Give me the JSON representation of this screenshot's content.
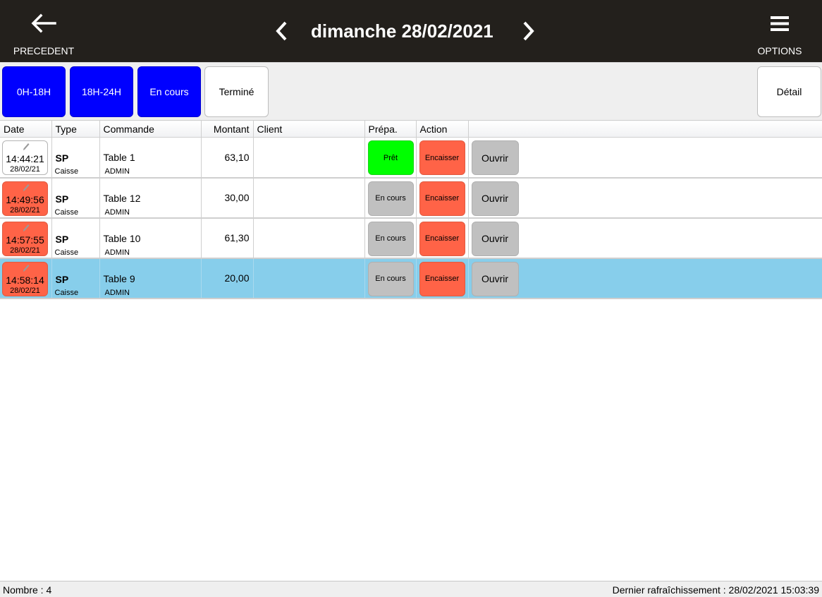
{
  "header": {
    "back_label": "PRECEDENT",
    "back_icon": "arrow-left-icon",
    "date_title": "dimanche 28/02/2021",
    "prev_day_icon": "chevron-left-icon",
    "next_day_icon": "chevron-right-icon",
    "options_label": "OPTIONS",
    "options_icon": "hamburger-menu-icon"
  },
  "filters": {
    "buttons": [
      {
        "label": "0H-18H",
        "active": true
      },
      {
        "label": "18H-24H",
        "active": true
      },
      {
        "label": "En cours",
        "active": true
      },
      {
        "label": "Terminé",
        "active": false
      }
    ],
    "detail_label": "Détail"
  },
  "colors": {
    "header_bg": "#23201c",
    "filter_active": "#0000ff",
    "late_red": "#ff6347",
    "ready_green": "#00ff00",
    "neutral_gray": "#c0c0c0",
    "selected_row": "#87ceeb"
  },
  "table": {
    "columns": [
      "Date",
      "Type",
      "Commande",
      "Montant",
      "Client",
      "Prépa.",
      "Action",
      ""
    ],
    "rows": [
      {
        "time": "14:44:21",
        "date": "28/02/21",
        "date_style": "white",
        "type": "SP",
        "type_sub": "Caisse",
        "order": "Table 1",
        "user": "ADMIN",
        "amount": "63,10",
        "client": "",
        "prep": "Prêt",
        "prep_style": "green",
        "action": "Encaisser",
        "open": "Ouvrir",
        "selected": false
      },
      {
        "time": "14:49:56",
        "date": "28/02/21",
        "date_style": "red",
        "type": "SP",
        "type_sub": "Caisse",
        "order": "Table 12",
        "user": "ADMIN",
        "amount": "30,00",
        "client": "",
        "prep": "En cours",
        "prep_style": "gray",
        "action": "Encaisser",
        "open": "Ouvrir",
        "selected": false
      },
      {
        "time": "14:57:55",
        "date": "28/02/21",
        "date_style": "red",
        "type": "SP",
        "type_sub": "Caisse",
        "order": "Table 10",
        "user": "ADMIN",
        "amount": "61,30",
        "client": "",
        "prep": "En cours",
        "prep_style": "gray",
        "action": "Encaisser",
        "open": "Ouvrir",
        "selected": false
      },
      {
        "time": "14:58:14",
        "date": "28/02/21",
        "date_style": "red",
        "type": "SP",
        "type_sub": "Caisse",
        "order": "Table 9",
        "user": "ADMIN",
        "amount": "20,00",
        "client": "",
        "prep": "En cours",
        "prep_style": "gray",
        "action": "Encaisser",
        "open": "Ouvrir",
        "selected": true
      }
    ]
  },
  "status": {
    "count_text": "Nombre : 4",
    "refresh_text": "Dernier rafraîchissement : 28/02/2021 15:03:39"
  }
}
